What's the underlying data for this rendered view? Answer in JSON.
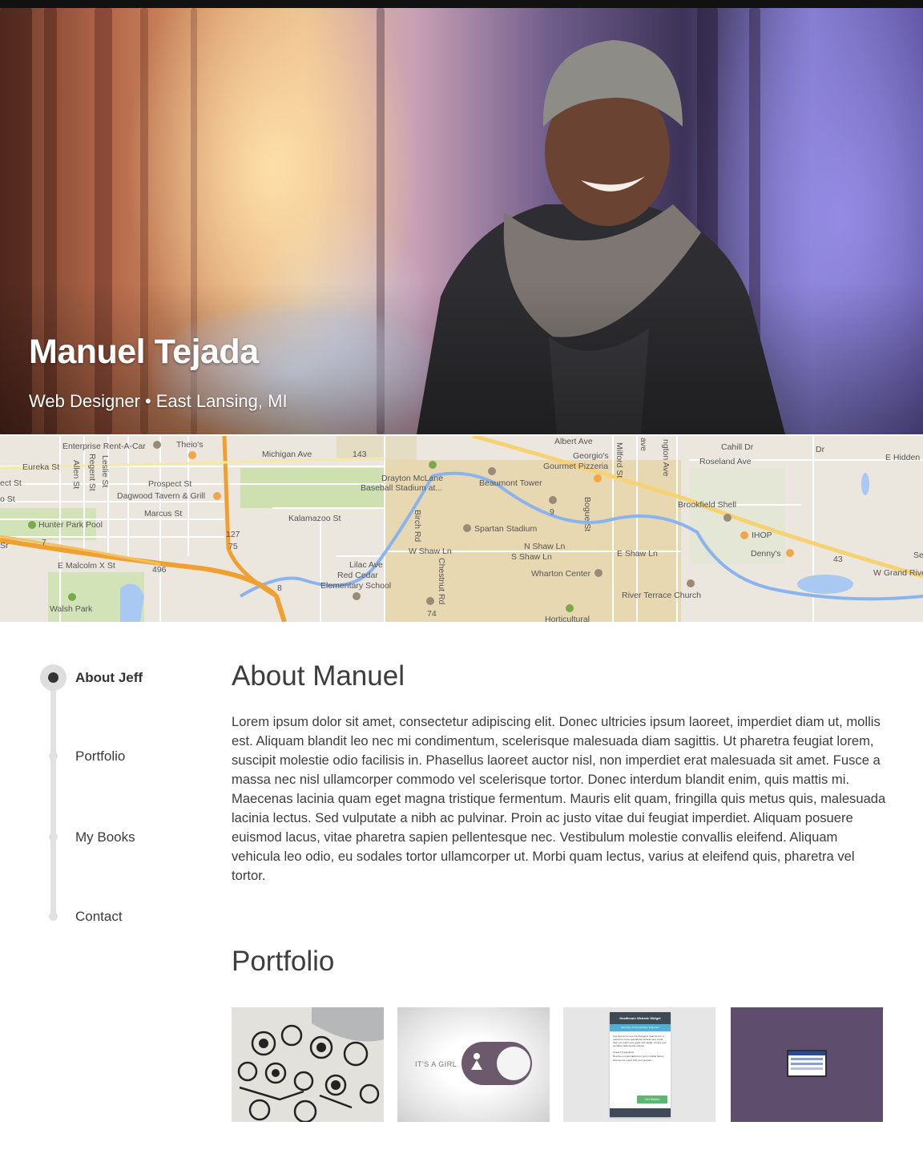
{
  "profile": {
    "name": "Manuel Tejada",
    "role": "Web Designer",
    "separator": "•",
    "location": "East Lansing, MI"
  },
  "map": {
    "labels": {
      "enterprise": "Enterprise Rent-A-Car",
      "theios": "Theio's",
      "michigan_ave": "Michigan Ave",
      "route_143": "143",
      "albert_ave": "Albert Ave",
      "georgios": "Georgio's",
      "gourmet": "Gourmet Pizzeria",
      "cahill": "Cahill Dr",
      "roseland": "Roseland Ave",
      "e_hidden": "E Hidden",
      "eureka": "Eureka St",
      "allen": "Allen St",
      "regent": "Regent St",
      "leslie": "Leslie St",
      "ect": "ect St",
      "prospect": "Prospect St",
      "dagwood": "Dagwood Tavern & Grill",
      "marcus": "Marcus St",
      "o_st": "o St",
      "drayton": "Drayton McLane",
      "baseball": "Baseball Stadium at...",
      "beaumont": "Beaumont Tower",
      "kalamazoo": "Kalamazoo St",
      "birch": "Birch Rd",
      "route_9": "9",
      "bogue": "Bogue St",
      "brookfield": "Brookfield Shell",
      "hunter": "Hunter Park Pool",
      "route_127": "127",
      "route_75": "75",
      "spartan": "Spartan Stadium",
      "ihop": "IHOP",
      "dennys": "Denny's",
      "route_43": "43",
      "w_grand": "W Grand Rive",
      "e_malcolm": "E Malcolm X St",
      "route_496": "496",
      "route_7": "7",
      "route_8": "8",
      "w_shaw": "W Shaw Ln",
      "n_shaw": "N Shaw Ln",
      "s_shaw": "S Shaw Ln",
      "e_shaw": "E Shaw Ln",
      "lilac": "Lilac Ave",
      "red_cedar": "Red Cedar",
      "elementary": "Elementary School",
      "chestnut": "Chestnut Rd",
      "wharton": "Wharton Center",
      "river_terrace": "River Terrace Church",
      "walsh": "Walsh Park",
      "route_74": "74",
      "horticultural": "Horticultural",
      "milford": "Milford St",
      "ave_a": "ave",
      "ngton": "ngton Ave",
      "dr": "Dr",
      "sr": "Sr",
      "se": "Se"
    }
  },
  "nav": {
    "items": [
      {
        "label": "About Jeff"
      },
      {
        "label": "Portfolio"
      },
      {
        "label": "My Books"
      },
      {
        "label": "Contact"
      }
    ]
  },
  "about": {
    "title": "About Manuel",
    "body": "Lorem ipsum dolor sit amet, consectetur adipiscing elit. Donec ultricies ipsum laoreet, imperdiet diam ut, mollis est. Aliquam blandit leo nec mi condimentum, scelerisque malesuada diam sagittis. Ut pharetra feugiat lorem, suscipit molestie odio facilisis in. Phasellus laoreet auctor nisl, non imperdiet erat malesuada sit amet. Fusce a massa nec nisl ullamcorper commodo vel scelerisque tortor. Donec interdum blandit enim, quis mattis mi. Maecenas lacinia quam eget magna tristique fermentum. Mauris elit quam, fringilla quis metus quis, malesuada lacinia lectus. Sed vulputate a nibh ac pulvinar. Proin ac justo vitae dui feugiat imperdiet. Aliquam posuere euismod lacus, vitae pharetra sapien pellentesque nec. Vestibulum molestie convallis eleifend. Aliquam vehicula leo odio, eu sodales tortor ullamcorper ut. Morbi quam lectus, varius at eleifend quis, pharetra vel tortor."
  },
  "portfolio": {
    "title": "Portfolio",
    "thumb2": {
      "caption": "IT'S A GIRL"
    },
    "thumb3": {
      "header": "Healthcare Website Widget",
      "tabs": "Educate | Communicate | Empower",
      "intro": "Use this tool to see if a change in treatment or a referral to more specialized medical care could help you reach your goals and ideally, control your condition without side effects!",
      "steps": [
        "Answer 6 questions",
        "Receive a report tailored to your medical history",
        "Discuss the report with your provider"
      ],
      "button": "Get Started"
    }
  }
}
